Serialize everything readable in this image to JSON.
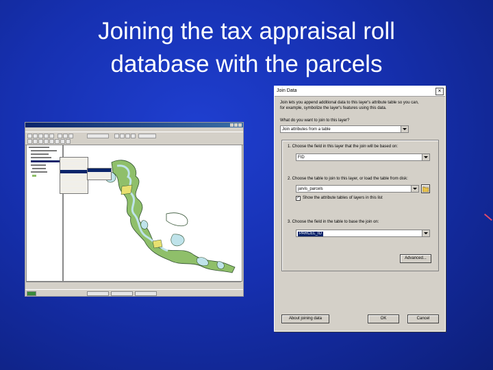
{
  "slide": {
    "title_line1": "Joining the tax appraisal roll",
    "title_line2": "database with the parcels"
  },
  "dialog": {
    "title": "Join Data",
    "intro_line1": "Join lets you append additional data to this layer's attribute table so you can,",
    "intro_line2": "for example, symbolize the layer's features using this data.",
    "question": "What do you want to join to this layer?",
    "join_type": "Join attributes from a table",
    "step1_label": "1.  Choose the field in this layer that the join will be based on:",
    "step1_value": "FID",
    "step2_label": "2.  Choose the table to join to this layer, or load the table from disk:",
    "step2_value": "jarvis_parcels",
    "show_attribute_tables": "Show the attribute tables of layers in this list",
    "step3_label": "3.  Choose the field in the table to base the join on:",
    "step3_value": "PARCEL_ID",
    "advanced_button": "Advanced...",
    "about_button": "About joining data",
    "ok_button": "OK",
    "cancel_button": "Cancel"
  },
  "colors": {
    "background": "#1630b0",
    "title_text": "#ffffff",
    "dialog_face": "#d4d0c8",
    "selection": "#0a246a",
    "map_lake": "#bfe3ea",
    "map_land": "#8fbf6a"
  }
}
